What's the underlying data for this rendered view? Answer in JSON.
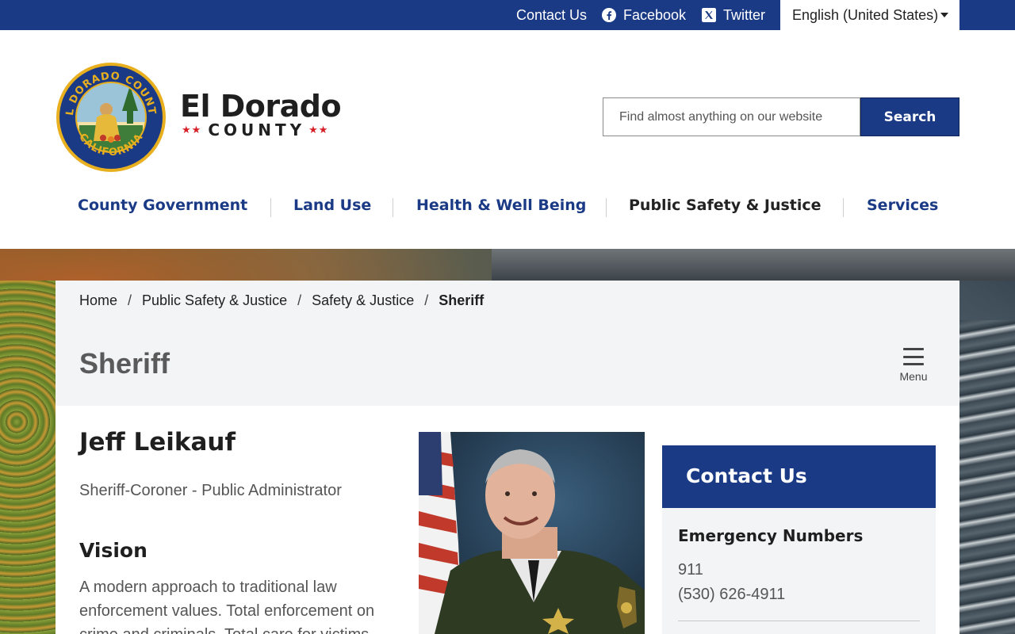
{
  "utility_bar": {
    "contact_label": "Contact Us",
    "facebook_label": "Facebook",
    "twitter_label": "Twitter",
    "language_selected": "English (United States)"
  },
  "brand": {
    "name": "El Dorado",
    "sub": "COUNTY",
    "seal_top_text": "EL DORADO COUNTY",
    "seal_bottom_text": "CALIFORNIA"
  },
  "search": {
    "placeholder": "Find almost anything on our website",
    "button_label": "Search"
  },
  "nav": {
    "items": [
      {
        "label": "County Government"
      },
      {
        "label": "Land Use"
      },
      {
        "label": "Health & Well Being"
      },
      {
        "label": "Public Safety & Justice"
      },
      {
        "label": "Services"
      }
    ]
  },
  "breadcrumb": {
    "items": [
      "Home",
      "Public Safety & Justice",
      "Safety & Justice"
    ],
    "current": "Sheriff",
    "separator": "/"
  },
  "page": {
    "title": "Sheriff",
    "menu_label": "Menu"
  },
  "profile": {
    "name": "Jeff Leikauf",
    "title": "Sheriff-Coroner - Public Administrator",
    "vision_heading": "Vision",
    "vision_text": "A modern approach to traditional law enforcement values. Total enforcement on crime and criminals. Total care for victims."
  },
  "contact": {
    "heading": "Contact Us",
    "emergency_heading": "Emergency Numbers",
    "numbers": [
      "911",
      "(530) 626-4911"
    ]
  },
  "colors": {
    "brand_blue": "#1b3a86",
    "star_red": "#d62027",
    "panel_gray": "#f3f4f6"
  },
  "icons": {
    "facebook": "facebook-icon",
    "twitter": "x-twitter-icon",
    "menu": "hamburger-menu-icon",
    "language_caret": "caret-down-icon"
  }
}
